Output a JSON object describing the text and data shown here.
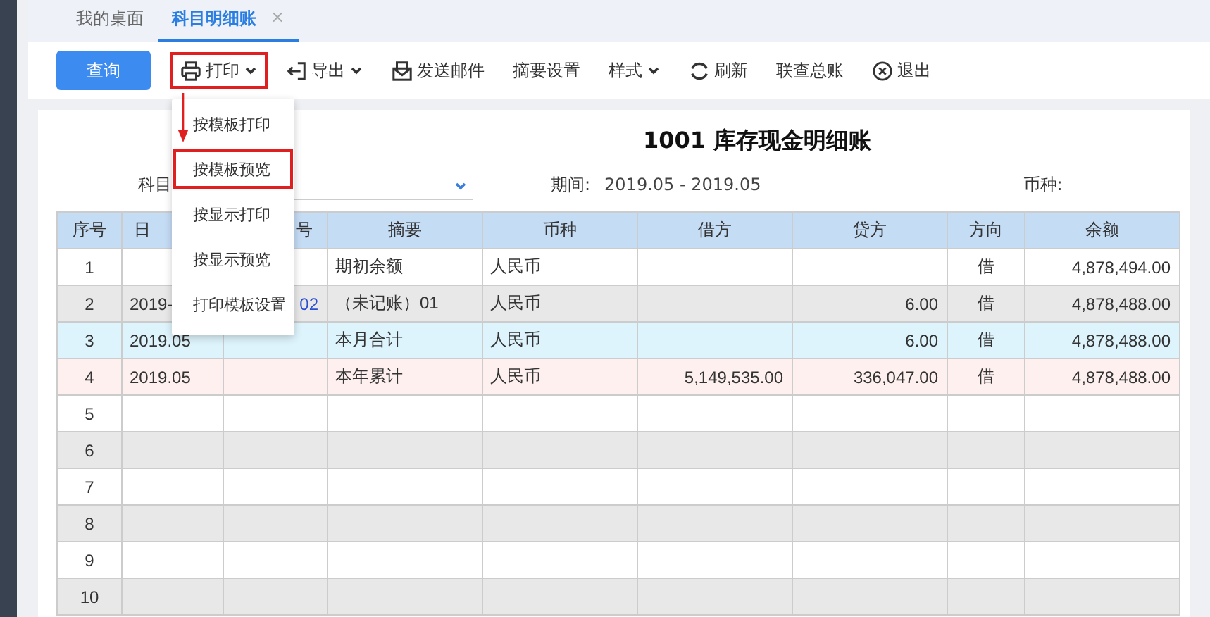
{
  "tabs": [
    {
      "label": "我的桌面",
      "selected": false
    },
    {
      "label": "科目明细账",
      "selected": true,
      "close": "×"
    }
  ],
  "toolbar": [
    {
      "label": "查询",
      "kind": "primary",
      "dropdown": false,
      "annotated": false
    },
    {
      "label": "打印",
      "kind": "icon",
      "dropdown": true,
      "annotated": true
    },
    {
      "label": "导出",
      "kind": "icon",
      "dropdown": true,
      "annotated": false
    },
    {
      "label": "发送邮件",
      "kind": "icon",
      "dropdown": false,
      "annotated": false
    },
    {
      "label": "摘要设置",
      "kind": "plain",
      "dropdown": false,
      "annotated": false
    },
    {
      "label": "样式",
      "kind": "plain",
      "dropdown": true,
      "annotated": false
    },
    {
      "label": "刷新",
      "kind": "icon",
      "dropdown": false,
      "annotated": false
    },
    {
      "label": "联查总账",
      "kind": "plain",
      "dropdown": false,
      "annotated": false
    },
    {
      "label": "退出",
      "kind": "icon",
      "dropdown": false,
      "annotated": false
    }
  ],
  "print_menu": [
    {
      "label": "按模板打印",
      "annotated": false
    },
    {
      "label": "按模板预览",
      "annotated": true
    },
    {
      "label": "按显示打印",
      "annotated": false
    },
    {
      "label": "按显示预览",
      "annotated": false
    },
    {
      "label": "打印模板设置",
      "annotated": false
    }
  ],
  "report": {
    "title": "1001 库存现金明细账",
    "subject_label": "科目",
    "period_label": "期间:",
    "period": "2019.05 - 2019.05",
    "currency_label": "币种:"
  },
  "table": {
    "columns": [
      "序号",
      "日",
      "号",
      "摘要",
      "币种",
      "借方",
      "贷方",
      "方向",
      "余额"
    ],
    "rows": [
      {
        "kind": "normal",
        "cells": [
          "1",
          "",
          "",
          "期初余额",
          "人民币",
          "",
          "",
          "借",
          "4,878,494.00"
        ]
      },
      {
        "kind": "normal",
        "cells": [
          "2",
          "2019-",
          "02",
          "（未记账）01",
          "人民币",
          "",
          "6.00",
          "借",
          "4,878,488.00"
        ]
      },
      {
        "kind": "month_total",
        "cells": [
          "3",
          "2019.05",
          "",
          "本月合计",
          "人民币",
          "",
          "6.00",
          "借",
          "4,878,488.00"
        ]
      },
      {
        "kind": "year_total",
        "cells": [
          "4",
          "2019.05",
          "",
          "本年累计",
          "人民币",
          "5,149,535.00",
          "336,047.00",
          "借",
          "4,878,488.00"
        ]
      },
      {
        "kind": "normal",
        "cells": [
          "5",
          "",
          "",
          "",
          "",
          "",
          "",
          "",
          ""
        ]
      },
      {
        "kind": "normal",
        "cells": [
          "6",
          "",
          "",
          "",
          "",
          "",
          "",
          "",
          ""
        ]
      },
      {
        "kind": "normal",
        "cells": [
          "7",
          "",
          "",
          "",
          "",
          "",
          "",
          "",
          ""
        ]
      },
      {
        "kind": "normal",
        "cells": [
          "8",
          "",
          "",
          "",
          "",
          "",
          "",
          "",
          ""
        ]
      },
      {
        "kind": "normal",
        "cells": [
          "9",
          "",
          "",
          "",
          "",
          "",
          "",
          "",
          ""
        ]
      },
      {
        "kind": "normal",
        "cells": [
          "10",
          "",
          "",
          "",
          "",
          "",
          "",
          "",
          ""
        ]
      }
    ]
  }
}
